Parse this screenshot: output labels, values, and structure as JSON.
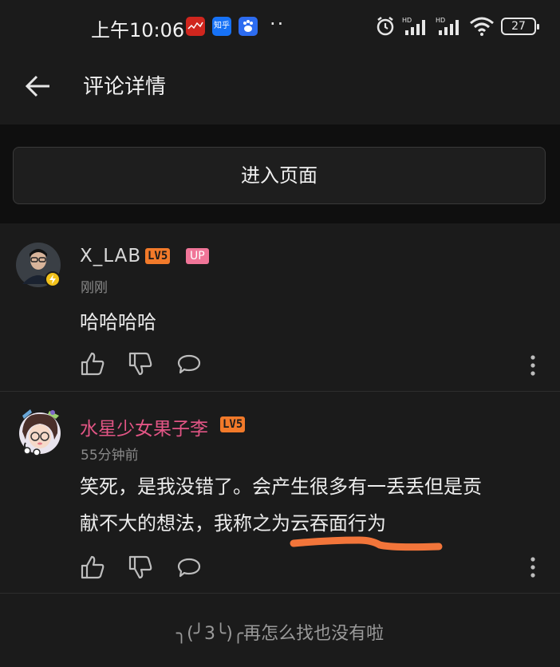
{
  "status_bar": {
    "time": "上午10:06",
    "zhihu_badge": "知乎",
    "dots": "··",
    "battery": "27"
  },
  "header": {
    "title": "评论详情"
  },
  "enter_button": {
    "label": "进入页面"
  },
  "comments": [
    {
      "username": "X_LAB",
      "level": "LV5",
      "up_badge": "UP",
      "time": "刚刚",
      "text": "哈哈哈哈"
    },
    {
      "username": "水星少女果子李",
      "level": "LV5",
      "time": "55分钟前",
      "text_line1": "笑死，是我没错了。会产生很多有一丢丢但是贡",
      "text_line2": "献不大的想法，我称之为云吞面行为"
    }
  ],
  "footer": {
    "text": "╮(╯3╰)╭再怎么找也没有啦"
  },
  "colors": {
    "background": "#1b1b1b",
    "level_badge": "#f27a2a",
    "up_badge": "#f07598",
    "username_pink": "#e25585",
    "annotation_stroke": "#f2753a"
  }
}
